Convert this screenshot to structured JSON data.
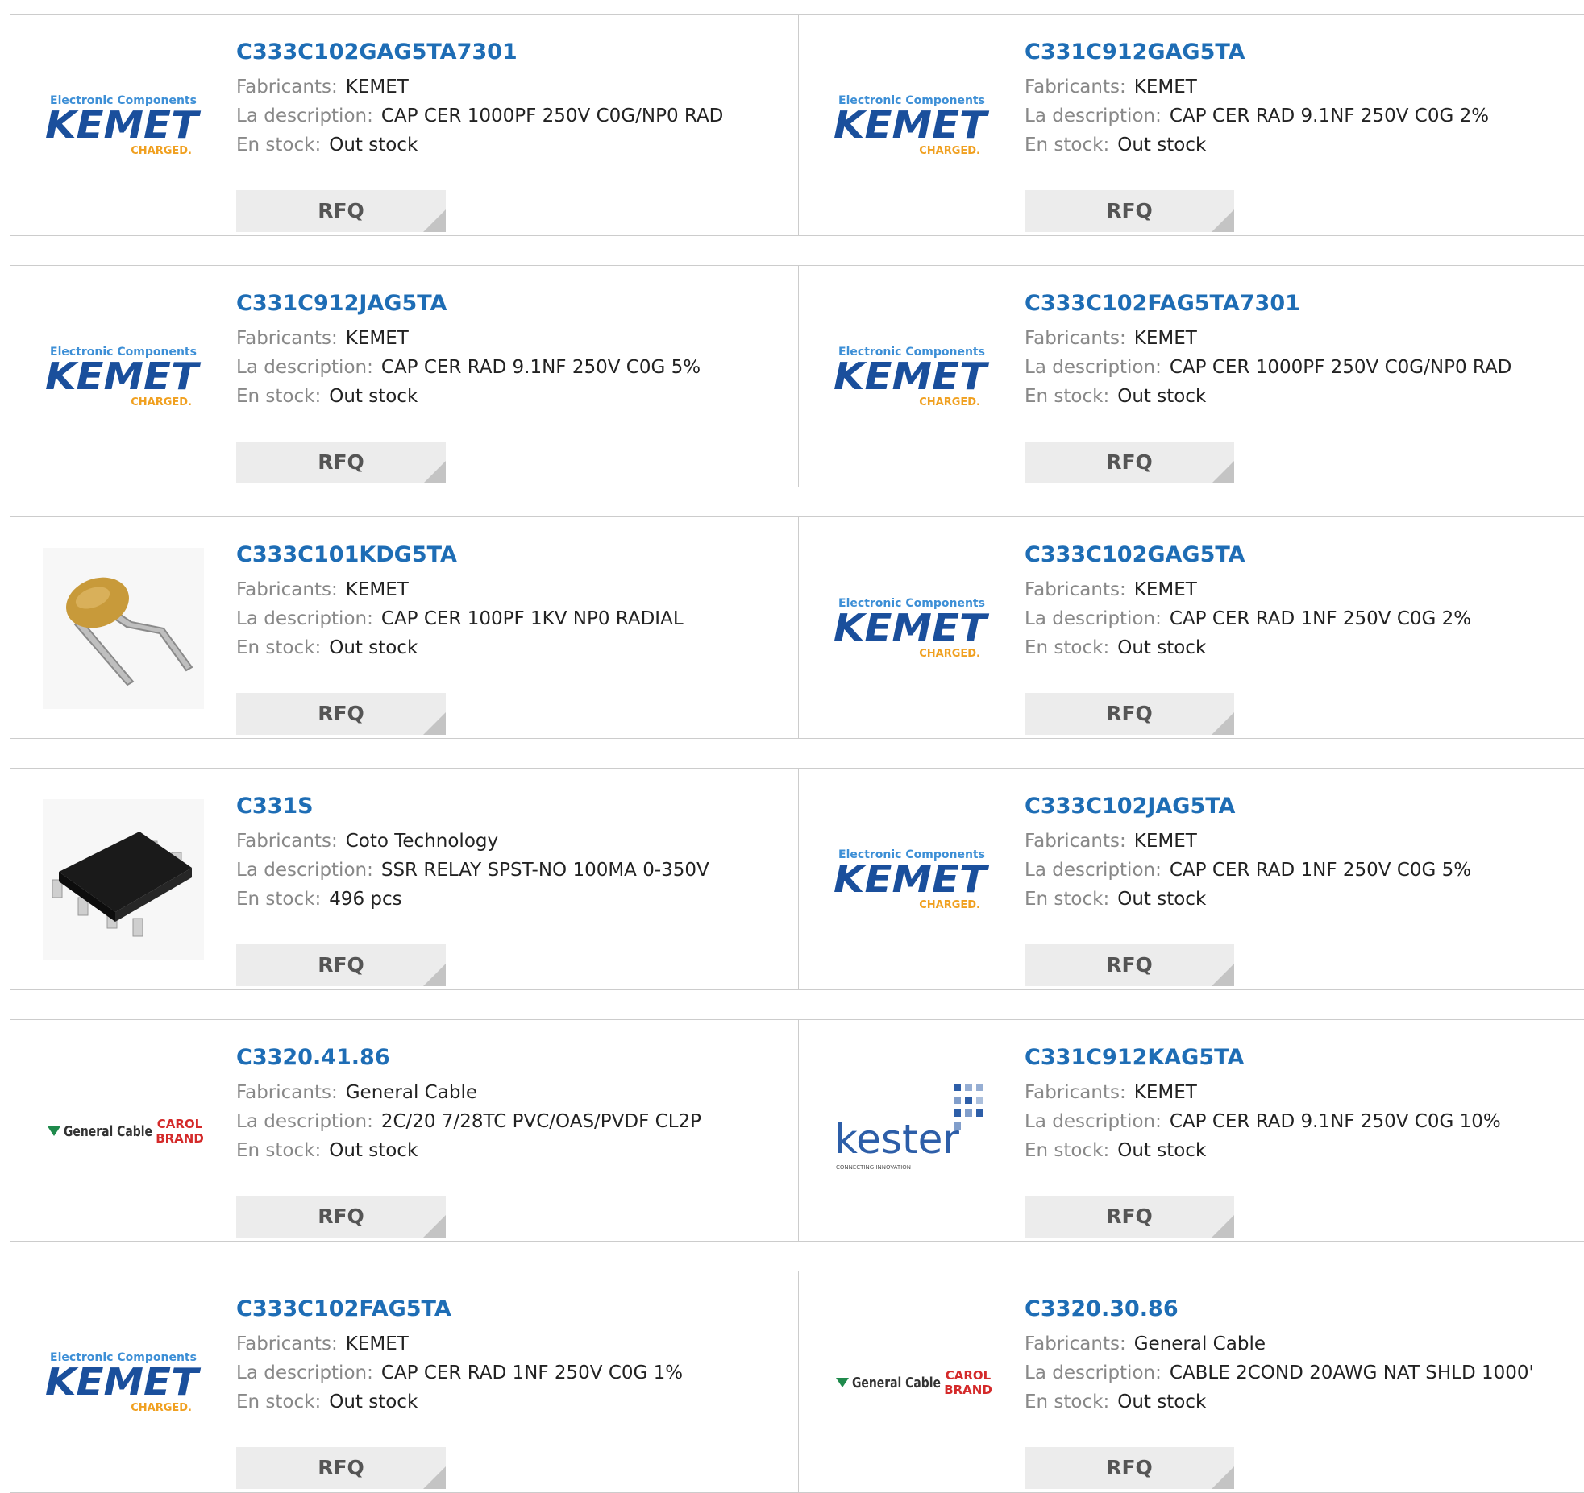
{
  "labels": {
    "manufacturer": "Fabricants:",
    "description": "La description:",
    "stock": "En stock:",
    "rfq": "RFQ"
  },
  "logo_texts": {
    "kemet_tagline": "Electronic Components",
    "kemet_name": "KEMET",
    "kemet_charged": "CHARGED.",
    "kester_name": "kester",
    "kester_tagline": "CONNECTING INNOVATION",
    "gencable_name": "General Cable",
    "carol_line1": "CAROL",
    "carol_line2": "BRAND"
  },
  "colors": {
    "link": "#1e6db5",
    "kemet_blue": "#1a4f9c",
    "kemet_orange": "#f0a020",
    "kester_blue": "#2d5ea8",
    "carol_red": "#d42a2a",
    "gencable_green": "#1f8a4c"
  },
  "products": [
    {
      "part": "C333C102GAG5TA7301",
      "manufacturer": "KEMET",
      "description": "CAP CER 1000PF 250V C0G/NP0 RAD",
      "stock": "Out stock",
      "logo": "kemet-logo"
    },
    {
      "part": "C331C912GAG5TA",
      "manufacturer": "KEMET",
      "description": "CAP CER RAD 9.1NF 250V C0G 2%",
      "stock": "Out stock",
      "logo": "kemet-logo"
    },
    {
      "part": "C331C912JAG5TA",
      "manufacturer": "KEMET",
      "description": "CAP CER RAD 9.1NF 250V C0G 5%",
      "stock": "Out stock",
      "logo": "kemet-logo"
    },
    {
      "part": "C333C102FAG5TA7301",
      "manufacturer": "KEMET",
      "description": "CAP CER 1000PF 250V C0G/NP0 RAD",
      "stock": "Out stock",
      "logo": "kemet-logo"
    },
    {
      "part": "C333C101KDG5TA",
      "manufacturer": "KEMET",
      "description": "CAP CER 100PF 1KV NP0 RADIAL",
      "stock": "Out stock",
      "logo": "capacitor-photo"
    },
    {
      "part": "C333C102GAG5TA",
      "manufacturer": "KEMET",
      "description": "CAP CER RAD 1NF 250V C0G 2%",
      "stock": "Out stock",
      "logo": "kemet-logo"
    },
    {
      "part": "C331S",
      "manufacturer": "Coto Technology",
      "description": "SSR RELAY SPST-NO 100MA 0-350V",
      "stock": "496 pcs",
      "logo": "relay-chip-photo"
    },
    {
      "part": "C333C102JAG5TA",
      "manufacturer": "KEMET",
      "description": "CAP CER RAD 1NF 250V C0G 5%",
      "stock": "Out stock",
      "logo": "kemet-logo"
    },
    {
      "part": "C3320.41.86",
      "manufacturer": "General Cable",
      "description": "2C/20 7/28TC PVC/OAS/PVDF CL2P",
      "stock": "Out stock",
      "logo": "general-cable-logo"
    },
    {
      "part": "C331C912KAG5TA",
      "manufacturer": "KEMET",
      "description": "CAP CER RAD 9.1NF 250V C0G 10%",
      "stock": "Out stock",
      "logo": "kester-logo"
    },
    {
      "part": "C333C102FAG5TA",
      "manufacturer": "KEMET",
      "description": "CAP CER RAD 1NF 250V C0G 1%",
      "stock": "Out stock",
      "logo": "kemet-logo"
    },
    {
      "part": "C3320.30.86",
      "manufacturer": "General Cable",
      "description": "CABLE 2COND 20AWG NAT SHLD 1000'",
      "stock": "Out stock",
      "logo": "general-cable-logo"
    }
  ]
}
